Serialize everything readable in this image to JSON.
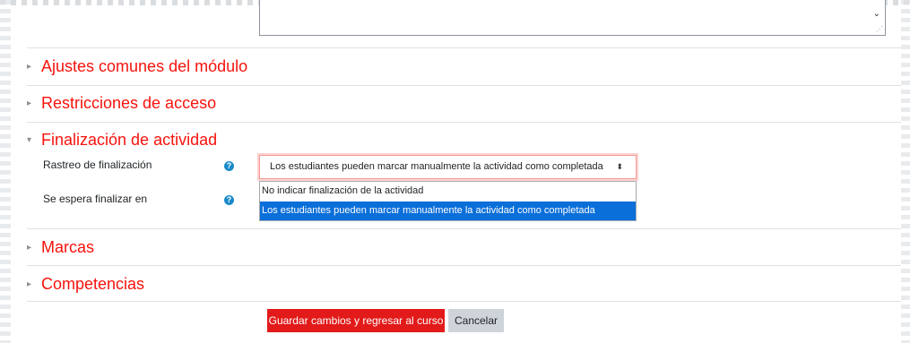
{
  "textarea": {
    "scroll_glyph": "⌄",
    "resize_glyph": "⋰"
  },
  "sections": {
    "module_settings": {
      "title": "Ajustes comunes del módulo",
      "caret": "▸"
    },
    "access_restrictions": {
      "title": "Restricciones de acceso",
      "caret": "▸"
    },
    "completion": {
      "title": "Finalización de actividad",
      "caret": "▾"
    },
    "tags": {
      "title": "Marcas",
      "caret": "▸"
    },
    "competencies": {
      "title": "Competencias",
      "caret": "▸"
    }
  },
  "completion": {
    "tracking_label": "Rastreo de finalización",
    "expected_label": "Se espera finalizar en",
    "help_glyph": "?",
    "select_value": "Los estudiantes pueden marcar manualmente la actividad como completada",
    "select_arrow": "⬍",
    "options": [
      "No indicar finalización de la actividad",
      "Los estudiantes pueden marcar manualmente la actividad como completada"
    ]
  },
  "buttons": {
    "save_return": "Guardar cambios y regresar al curso",
    "cancel": "Cancelar"
  },
  "colors": {
    "accent": "#f7130d",
    "primary_button": "#e21a1a",
    "selected_option": "#0a6fd9",
    "help_icon": "#1a8ac8"
  }
}
